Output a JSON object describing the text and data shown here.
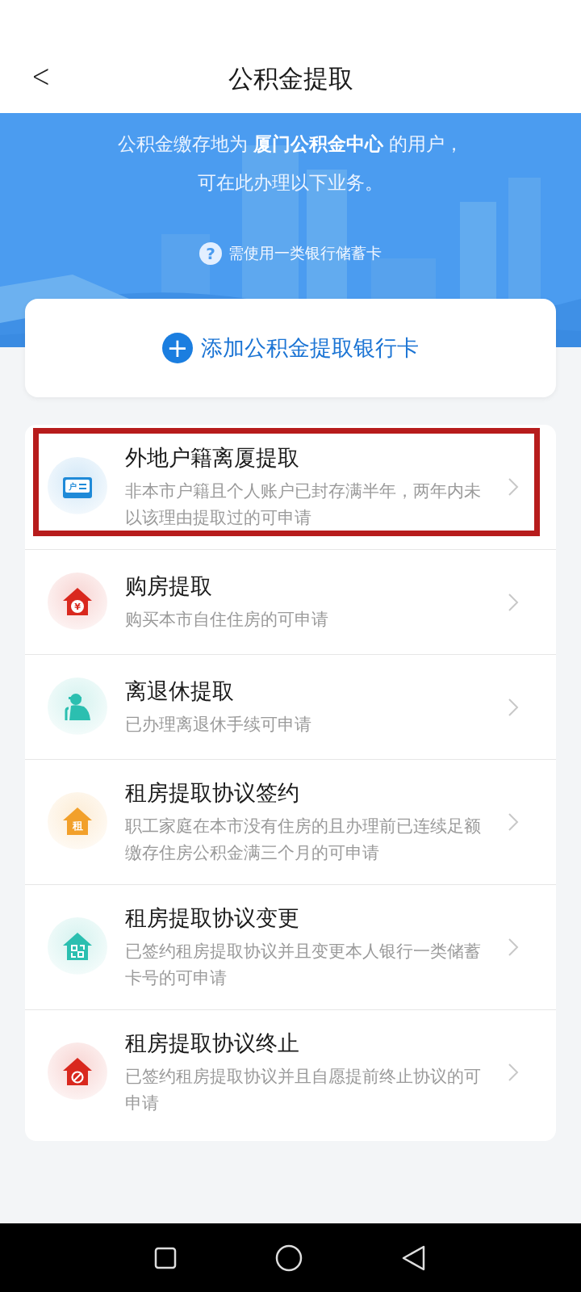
{
  "header": {
    "back": "<",
    "title": "公积金提取"
  },
  "banner": {
    "kind": "picture",
    "lines": [
      "公积金缴存地为 **厦门公积金中心** 的用户，",
      "可在此办理以下业务。"
    ],
    "help": {
      "icon": "?",
      "text": "需使用一类银行储蓄卡"
    }
  },
  "add_card": {
    "icon": "+",
    "label": "添加公积金提取银行卡"
  },
  "items": [
    {
      "title": "外地户籍离厦提取",
      "subtitle": "非本市户籍且个人账户已封存满半年，两年内未以该理由提取过的可申请",
      "icon": {
        "kind": "card",
        "label": "户",
        "color": "#1f8ad8"
      },
      "highlighted": true
    },
    {
      "title": "购房提取",
      "subtitle": "购买本市自住住房的可申请",
      "icon": {
        "kind": "house",
        "label": "¥",
        "color": "#d9281e"
      },
      "highlighted": false
    },
    {
      "title": "离退休提取",
      "subtitle": "已办理离退休手续可申请",
      "icon": {
        "kind": "elder",
        "color": "#2bbfb0"
      },
      "highlighted": false
    },
    {
      "title": "租房提取协议签约",
      "subtitle": "职工家庭在本市没有住房的且办理前已连续足额缴存住房公积金满三个月的可申请",
      "icon": {
        "kind": "house",
        "label": "租",
        "color": "#f2a02a"
      },
      "highlighted": false
    },
    {
      "title": "租房提取协议变更",
      "subtitle": "已签约租房提取协议并且变更本人银行一类储蓄卡号的可申请",
      "icon": {
        "kind": "house-swap",
        "color": "#2bbfb0"
      },
      "highlighted": false
    },
    {
      "title": "租房提取协议终止",
      "subtitle": "已签约租房提取协议并且自愿提前终止协议的可申请",
      "icon": {
        "kind": "house-stop",
        "color": "#d9281e"
      },
      "highlighted": false
    }
  ]
}
